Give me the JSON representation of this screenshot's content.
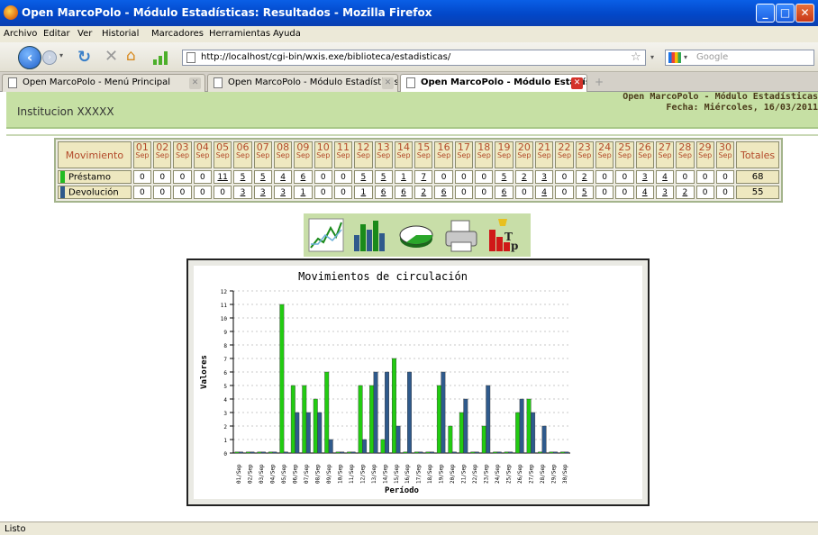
{
  "window": {
    "title": "Open MarcoPolo - Módulo Estadísticas: Resultados - Mozilla Firefox"
  },
  "menu": [
    "Archivo",
    "Editar",
    "Ver",
    "Historial",
    "Marcadores",
    "Herramientas",
    "Ayuda"
  ],
  "nav": {
    "url": "http://localhost/cgi-bin/wxis.exe/biblioteca/estadisticas/",
    "search_placeholder": "Google"
  },
  "tabs": [
    {
      "label": "Open MarcoPolo - Menú Principal"
    },
    {
      "label": "Open MarcoPolo - Módulo Estadísticas"
    },
    {
      "label": "Open MarcoPolo - Módulo Estadís..."
    }
  ],
  "page": {
    "institution": "Institucion XXXXX",
    "header_line1": "Open MarcoPolo - Módulo Estadísticas",
    "header_line2": "Fecha: Miércoles, 16/03/2011"
  },
  "table": {
    "label_header": "Movimiento",
    "total_header": "Totales",
    "month": "Sep",
    "days": [
      "01",
      "02",
      "03",
      "04",
      "05",
      "06",
      "07",
      "08",
      "09",
      "10",
      "11",
      "12",
      "13",
      "14",
      "15",
      "16",
      "17",
      "18",
      "19",
      "20",
      "21",
      "22",
      "23",
      "24",
      "25",
      "26",
      "27",
      "28",
      "29",
      "30"
    ],
    "rows": [
      {
        "label": "Préstamo",
        "color": "#22bb22",
        "values": [
          "0",
          "0",
          "0",
          "0",
          "11",
          "5",
          "5",
          "4",
          "6",
          "0",
          "0",
          "5",
          "5",
          "1",
          "7",
          "0",
          "0",
          "0",
          "5",
          "2",
          "3",
          "0",
          "2",
          "0",
          "0",
          "3",
          "4",
          "0",
          "0",
          "0"
        ],
        "total": "68"
      },
      {
        "label": "Devolución",
        "color": "#2f5a8c",
        "values": [
          "0",
          "0",
          "0",
          "0",
          "0",
          "3",
          "3",
          "3",
          "1",
          "0",
          "0",
          "1",
          "6",
          "6",
          "2",
          "6",
          "0",
          "0",
          "6",
          "0",
          "4",
          "0",
          "5",
          "0",
          "0",
          "4",
          "3",
          "2",
          "0",
          "0"
        ],
        "total": "55"
      }
    ]
  },
  "chart_icons": [
    "line-chart-icon",
    "bar-chart-icon",
    "pie-chart-icon",
    "printer-icon",
    "top-ranking-icon"
  ],
  "chart_data": {
    "type": "bar",
    "title": "Movimientos de circulación",
    "xlabel": "Período",
    "ylabel": "Valores",
    "ylim": [
      0,
      12
    ],
    "yticks": [
      0,
      1,
      2,
      3,
      4,
      5,
      6,
      7,
      8,
      9,
      10,
      11,
      12
    ],
    "grid": true,
    "categories": [
      "01/Sep",
      "02/Sep",
      "03/Sep",
      "04/Sep",
      "05/Sep",
      "06/Sep",
      "07/Sep",
      "08/Sep",
      "09/Sep",
      "10/Sep",
      "11/Sep",
      "12/Sep",
      "13/Sep",
      "14/Sep",
      "15/Sep",
      "16/Sep",
      "17/Sep",
      "18/Sep",
      "19/Sep",
      "20/Sep",
      "21/Sep",
      "22/Sep",
      "23/Sep",
      "24/Sep",
      "25/Sep",
      "26/Sep",
      "27/Sep",
      "28/Sep",
      "29/Sep",
      "30/Sep"
    ],
    "series": [
      {
        "name": "Préstamo",
        "color": "#22cc11",
        "values": [
          0,
          0,
          0,
          0,
          11,
          5,
          5,
          4,
          6,
          0,
          0,
          5,
          5,
          1,
          7,
          0,
          0,
          0,
          5,
          2,
          3,
          0,
          2,
          0,
          0,
          3,
          4,
          0,
          0,
          0
        ]
      },
      {
        "name": "Devolución",
        "color": "#2f5a8c",
        "values": [
          0,
          0,
          0,
          0,
          0,
          3,
          3,
          3,
          1,
          0,
          0,
          1,
          6,
          6,
          2,
          6,
          0,
          0,
          6,
          0,
          4,
          0,
          5,
          0,
          0,
          4,
          3,
          2,
          0,
          0
        ]
      }
    ]
  },
  "status": "Listo"
}
